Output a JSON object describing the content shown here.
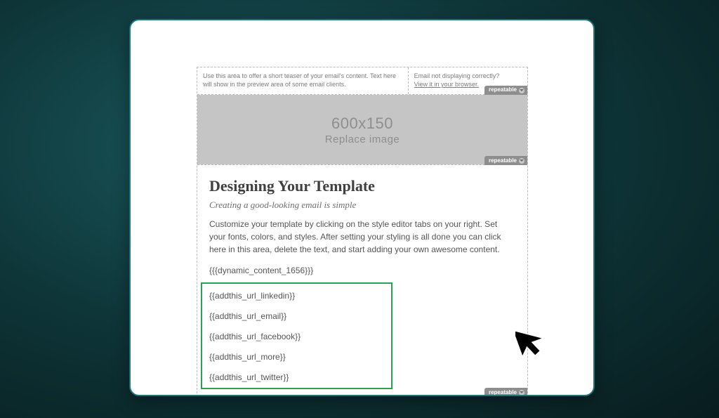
{
  "preheader": {
    "teaser": "Use this area to offer a short teaser of your email's content. Text here will show in the preview area of some email clients.",
    "notice": "Email not displaying correctly?",
    "link": "View it in your browser."
  },
  "repeatable_label": "repeatable",
  "hero": {
    "dimensions": "600x150",
    "caption": "Replace image"
  },
  "article": {
    "heading": "Designing Your Template",
    "subheading": "Creating a good-looking email is simple",
    "body": "Customize your template by clicking on the style editor tabs on your right. Set your fonts, colors, and styles. After setting your styling is all done you can click here in this area, delete the text, and start adding your own awesome content.",
    "dynamic_token": "{{{dynamic_content_1656}}}"
  },
  "addthis_tokens": [
    "{{addthis_url_linkedin}}",
    "{{addthis_url_email}}",
    "{{addthis_url_facebook}}",
    "{{addthis_url_more}}",
    "{{addthis_url_twitter}}"
  ]
}
